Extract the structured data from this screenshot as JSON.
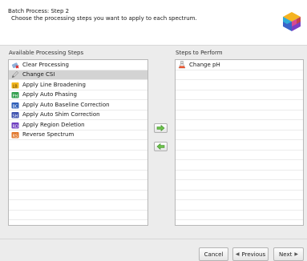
{
  "header": {
    "title": "Batch Process: Step 2",
    "subtitle": "Choose the processing steps you want to apply to each spectrum.",
    "logo_icon": "cube-logo-icon"
  },
  "available": {
    "label": "Available Processing Steps",
    "items": [
      {
        "label": "Clear Processing",
        "icon": "eraser-icon",
        "selected": false
      },
      {
        "label": "Change CSI",
        "icon": "pencil-icon",
        "selected": true
      },
      {
        "label": "Apply Line Broadening",
        "icon": "broadening-icon",
        "selected": false
      },
      {
        "label": "Apply Auto Phasing",
        "icon": "phasing-icon",
        "selected": false
      },
      {
        "label": "Apply Auto Baseline Correction",
        "icon": "baseline-icon",
        "selected": false
      },
      {
        "label": "Apply Auto Shim Correction",
        "icon": "shim-icon",
        "selected": false
      },
      {
        "label": "Apply Region Deletion",
        "icon": "region-icon",
        "selected": false
      },
      {
        "label": "Reverse Spectrum",
        "icon": "reverse-icon",
        "selected": false
      }
    ]
  },
  "perform": {
    "label": "Steps to Perform",
    "items": [
      {
        "label": "Change pH",
        "icon": "flask-icon"
      }
    ]
  },
  "buttons": {
    "add_icon": "arrow-right-icon",
    "remove_icon": "arrow-left-icon",
    "cancel": "Cancel",
    "previous": "Previous",
    "next": "Next"
  }
}
